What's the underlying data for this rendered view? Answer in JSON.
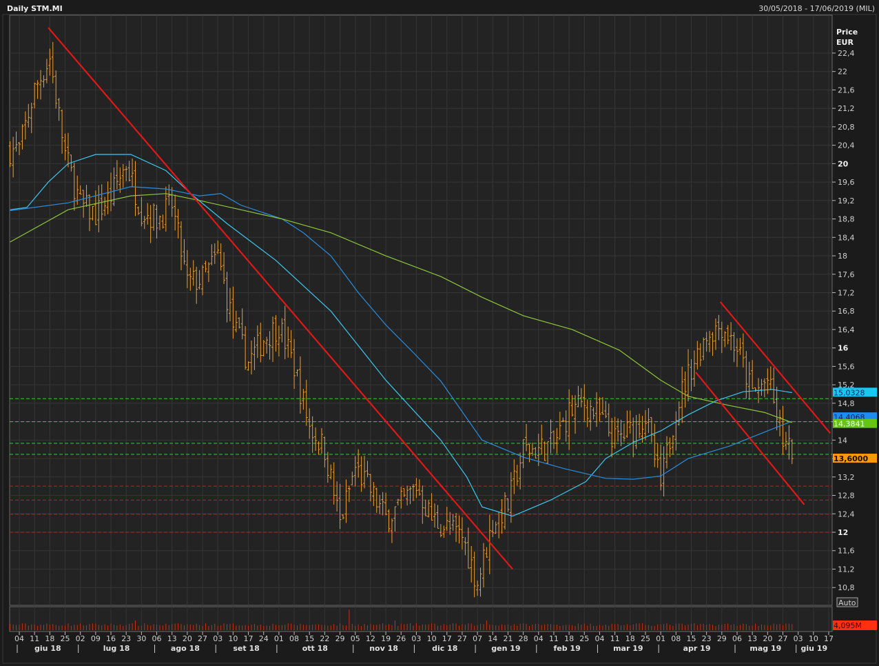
{
  "header": {
    "title": "Daily STM.MI",
    "range": "30/05/2018 - 17/06/2019 (MIL)"
  },
  "axis": {
    "price_label": "Price",
    "currency_label": "EUR",
    "auto_label": "Auto",
    "volume_label": "4,095M"
  },
  "value_tags": [
    {
      "text": "15,0328",
      "value": 15.0328,
      "bg": "#16c8f4",
      "fg": "#0a2a6a"
    },
    {
      "text": "14,4068",
      "value": 14.4068,
      "bg": "#1e8cf0",
      "fg": "#0a1a50"
    },
    {
      "text": "14,3841",
      "value": 14.3841,
      "bg": "#66c414",
      "fg": "#f0fff0"
    },
    {
      "text": "13,6000",
      "value": 13.6,
      "bg": "#ff9a00",
      "fg": "#1a0a00"
    }
  ],
  "colors": {
    "bars": "#f0a030",
    "fast_ma": "#3cc8f0",
    "mid_ma": "#2a8ee0",
    "slow_ma": "#8cc83a",
    "trend": "#e01818",
    "support_green": "#3cc83c",
    "support_red": "#c02020",
    "volume": "#c83010"
  },
  "chart_data": {
    "type": "ohlc",
    "title": "Daily STM.MI",
    "ylabel": "Price EUR",
    "ylim": [
      10.6,
      22.8
    ],
    "y_ticks": [
      "10,8",
      "11,2",
      "11,6",
      "12",
      "12,4",
      "12,8",
      "13,2",
      "13,6",
      "14",
      "14,4",
      "14,8",
      "15,2",
      "15,6",
      "16",
      "16,4",
      "16,8",
      "17,2",
      "17,6",
      "18",
      "18,4",
      "18,8",
      "19,2",
      "19,6",
      "20",
      "20,4",
      "20,8",
      "21,2",
      "21,6",
      "22",
      "22,4"
    ],
    "y_tick_values": [
      10.8,
      11.2,
      11.6,
      12,
      12.4,
      12.8,
      13.2,
      13.6,
      14,
      14.4,
      14.8,
      15.2,
      15.6,
      16,
      16.4,
      16.8,
      17.2,
      17.6,
      18,
      18.4,
      18.8,
      19.2,
      19.6,
      20,
      20.4,
      20.8,
      21.2,
      21.6,
      22,
      22.4
    ],
    "bold_ticks": [
      "12",
      "16",
      "20"
    ],
    "x_week_labels": [
      "04",
      "11",
      "18",
      "25",
      "02",
      "09",
      "16",
      "23",
      "30",
      "06",
      "13",
      "20",
      "27",
      "03",
      "10",
      "17",
      "24",
      "01",
      "08",
      "15",
      "22",
      "29",
      "05",
      "12",
      "19",
      "26",
      "03",
      "10",
      "17",
      "27",
      "07",
      "14",
      "21",
      "28",
      "04",
      "11",
      "18",
      "25",
      "04",
      "11",
      "18",
      "25",
      "01",
      "08",
      "15",
      "23",
      "29",
      "06",
      "13",
      "20",
      "27",
      "03",
      "10",
      "17"
    ],
    "months": [
      {
        "label": "giu 18",
        "start_week": 0,
        "end_week": 4
      },
      {
        "label": "lug 18",
        "start_week": 4,
        "end_week": 9
      },
      {
        "label": "ago 18",
        "start_week": 9,
        "end_week": 13
      },
      {
        "label": "set 18",
        "start_week": 13,
        "end_week": 17
      },
      {
        "label": "ott 18",
        "start_week": 17,
        "end_week": 22
      },
      {
        "label": "nov 18",
        "start_week": 22,
        "end_week": 26
      },
      {
        "label": "dic 18",
        "start_week": 26,
        "end_week": 30
      },
      {
        "label": "gen 19",
        "start_week": 30,
        "end_week": 34
      },
      {
        "label": "feb 19",
        "start_week": 34,
        "end_week": 38
      },
      {
        "label": "mar 19",
        "start_week": 38,
        "end_week": 42
      },
      {
        "label": "apr 19",
        "start_week": 42,
        "end_week": 47
      },
      {
        "label": "mag 19",
        "start_week": 47,
        "end_week": 51
      },
      {
        "label": "giu 19",
        "start_week": 51,
        "end_week": 54
      }
    ],
    "weekly_close": [
      20.3,
      21.6,
      22.3,
      20.2,
      19.1,
      18.9,
      19.3,
      20.0,
      19.0,
      18.8,
      19.1,
      17.4,
      17.5,
      18.0,
      16.5,
      15.7,
      16.2,
      16.5,
      15.6,
      14.3,
      13.8,
      12.2,
      13.4,
      12.9,
      12.3,
      12.6,
      13.0,
      12.3,
      12.1,
      11.9,
      10.9,
      12.2,
      12.6,
      13.8,
      13.8,
      13.9,
      14.6,
      14.8,
      14.5,
      14.0,
      14.2,
      14.5,
      13.0,
      14.7,
      15.6,
      16.3,
      16.5,
      16.0,
      15.0,
      15.3,
      14.0,
      13.4
    ],
    "last_close": 13.6,
    "last_week_index": 50.6,
    "series": [
      {
        "name": "fast_ma",
        "last": 15.0328,
        "points": [
          [
            -0.6,
            19.0
          ],
          [
            0.5,
            19.05
          ],
          [
            1.9,
            19.6
          ],
          [
            3.2,
            20.0
          ],
          [
            5.0,
            20.2
          ],
          [
            7.3,
            20.2
          ],
          [
            9.6,
            19.85
          ],
          [
            11.4,
            19.3
          ],
          [
            13.6,
            18.7
          ],
          [
            16.8,
            17.9
          ],
          [
            20.4,
            16.8
          ],
          [
            24.0,
            15.3
          ],
          [
            27.6,
            14.0
          ],
          [
            29.3,
            13.2
          ],
          [
            30.3,
            12.55
          ],
          [
            32.3,
            12.35
          ],
          [
            34.8,
            12.7
          ],
          [
            37.1,
            13.1
          ],
          [
            38.4,
            13.6
          ],
          [
            40.2,
            13.95
          ],
          [
            42.0,
            14.2
          ],
          [
            43.8,
            14.55
          ],
          [
            45.6,
            14.85
          ],
          [
            47.4,
            15.05
          ],
          [
            49.3,
            15.1
          ],
          [
            50.6,
            15.03
          ]
        ]
      },
      {
        "name": "mid_ma",
        "last": 14.4068,
        "points": [
          [
            -0.6,
            18.98
          ],
          [
            3.2,
            19.15
          ],
          [
            7.3,
            19.5
          ],
          [
            9.6,
            19.45
          ],
          [
            11.8,
            19.3
          ],
          [
            13.2,
            19.35
          ],
          [
            14.5,
            19.1
          ],
          [
            17.2,
            18.8
          ],
          [
            18.6,
            18.5
          ],
          [
            20.4,
            18.0
          ],
          [
            22.2,
            17.2
          ],
          [
            24.0,
            16.5
          ],
          [
            25.8,
            15.9
          ],
          [
            27.6,
            15.28
          ],
          [
            30.3,
            14.0
          ],
          [
            33.0,
            13.63
          ],
          [
            35.7,
            13.38
          ],
          [
            38.4,
            13.17
          ],
          [
            40.2,
            13.15
          ],
          [
            42.0,
            13.22
          ],
          [
            43.8,
            13.6
          ],
          [
            46.5,
            13.87
          ],
          [
            49.3,
            14.24
          ],
          [
            50.6,
            14.41
          ]
        ]
      },
      {
        "name": "slow_ma",
        "last": 14.3841,
        "points": [
          [
            -0.6,
            18.3
          ],
          [
            3.2,
            19.0
          ],
          [
            7.3,
            19.3
          ],
          [
            9.6,
            19.35
          ],
          [
            11.8,
            19.2
          ],
          [
            14.5,
            19.0
          ],
          [
            17.2,
            18.8
          ],
          [
            20.4,
            18.5
          ],
          [
            24.0,
            18.0
          ],
          [
            27.6,
            17.55
          ],
          [
            30.3,
            17.1
          ],
          [
            33.0,
            16.7
          ],
          [
            36.2,
            16.4
          ],
          [
            39.3,
            15.95
          ],
          [
            42.0,
            15.3
          ],
          [
            43.8,
            14.95
          ],
          [
            46.5,
            14.75
          ],
          [
            48.8,
            14.6
          ],
          [
            50.6,
            14.38
          ]
        ]
      }
    ],
    "trendlines": [
      {
        "from": [
          1.9,
          22.95
        ],
        "to": [
          32.3,
          11.2
        ]
      },
      {
        "from": [
          45.9,
          17.0
        ],
        "to": [
          53.1,
          14.15
        ]
      },
      {
        "from": [
          44.3,
          15.47
        ],
        "to": [
          51.4,
          12.6
        ]
      }
    ],
    "support_green": [
      14.9,
      14.4,
      13.93,
      13.69
    ],
    "support_red": [
      13.0,
      12.7,
      12.39,
      12.0
    ]
  }
}
